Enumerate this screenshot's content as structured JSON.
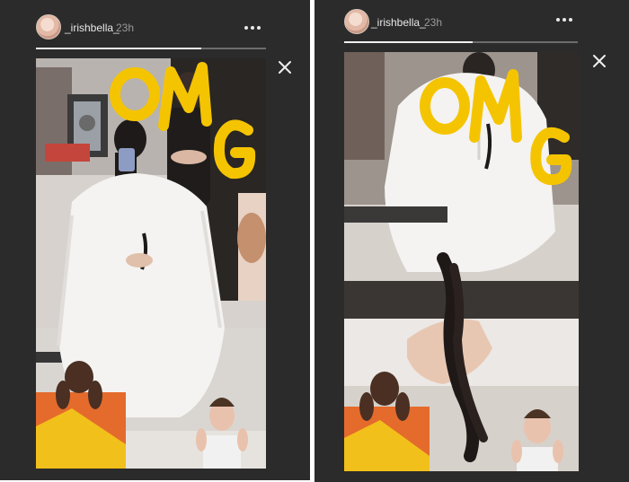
{
  "stories": [
    {
      "username": "_irishbella_",
      "time": "23h",
      "progress": 0.72,
      "sticker_text": "OMG",
      "icons": [
        "avatar",
        "more-icon",
        "close-icon"
      ]
    },
    {
      "username": "_irishbella_",
      "time": "23h",
      "progress": 0.55,
      "sticker_text": "OMG",
      "icons": [
        "avatar",
        "more-icon",
        "close-icon"
      ]
    }
  ],
  "colors": {
    "background": "#2b2b2b",
    "sticker": "#f5c400",
    "username": "#e8e8e8",
    "timestamp": "#9a9a9a"
  }
}
